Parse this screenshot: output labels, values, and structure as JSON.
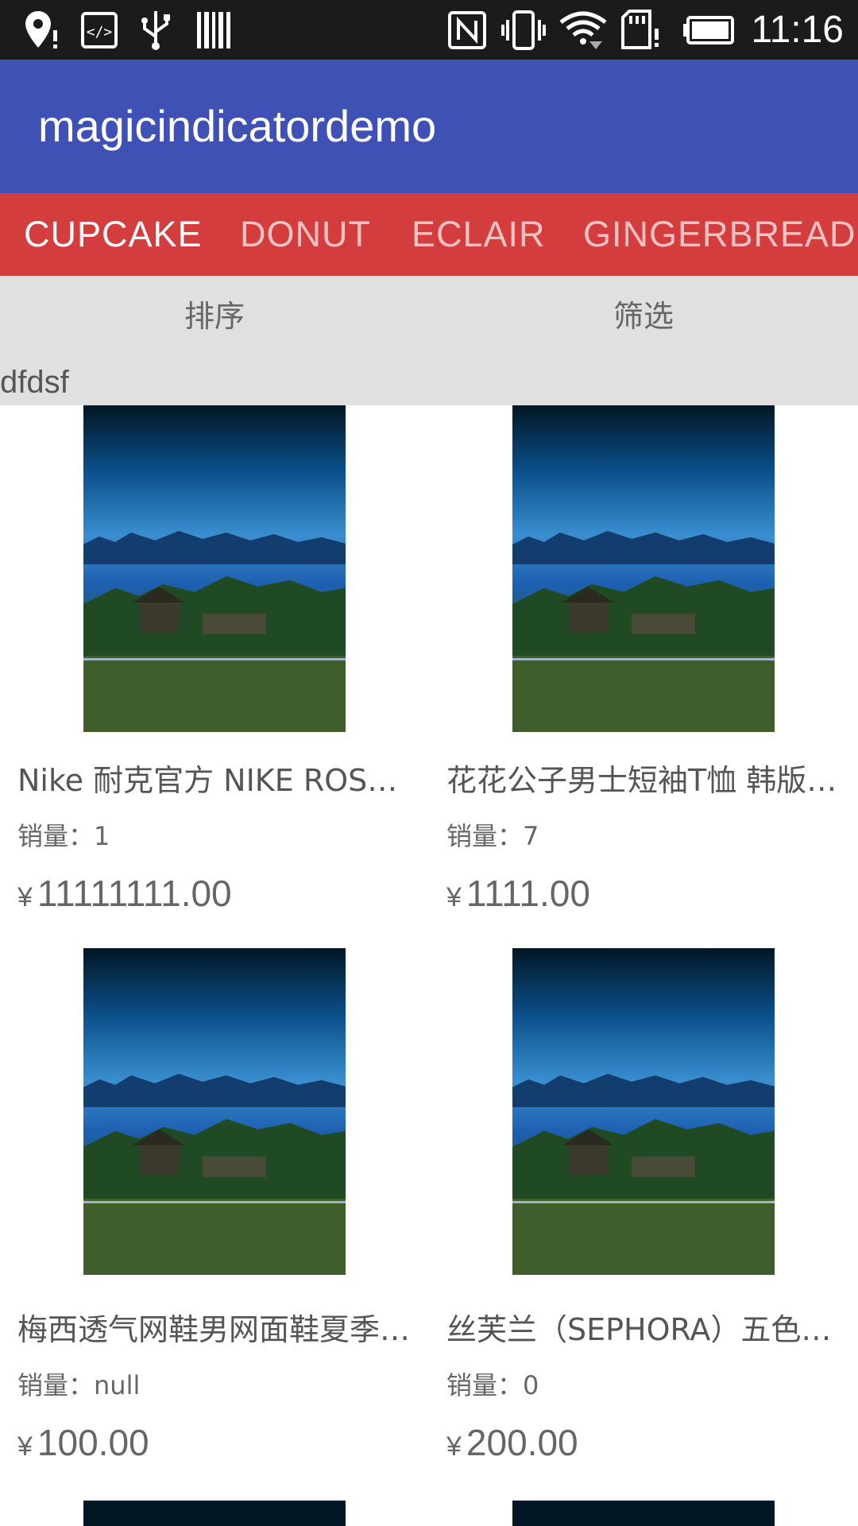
{
  "status_bar": {
    "time": "11:16",
    "icons": [
      "location-alert-icon",
      "code-icon",
      "usb-icon",
      "barcode-icon",
      "nfc-icon",
      "vibrate-icon",
      "wifi-icon",
      "sd-card-alert-icon",
      "battery-icon"
    ]
  },
  "app_bar": {
    "title": "magicindicatordemo",
    "background": "#3f51b5"
  },
  "tabs": {
    "background": "#d43d3d",
    "items": [
      {
        "label": "CUPCAKE",
        "active": true
      },
      {
        "label": "DONUT",
        "active": false
      },
      {
        "label": "ECLAIR",
        "active": false
      },
      {
        "label": "GINGERBREAD",
        "active": false
      }
    ]
  },
  "filter_bar": {
    "sort_label": "排序",
    "filter_label": "筛选",
    "note": "dfdsf"
  },
  "products": [
    {
      "title": "Nike 耐克官方 NIKE ROSHE ONE",
      "sales": "销量：1",
      "currency": "¥",
      "price": "11111111.00"
    },
    {
      "title": "花花公子男士短袖T恤 韩版修身",
      "sales": "销量：7",
      "currency": "¥",
      "price": "1111.00"
    },
    {
      "title": "梅西透气网鞋男网面鞋夏季跑步鞋",
      "sales": "销量：null",
      "currency": "¥",
      "price": "100.00"
    },
    {
      "title": "丝芙兰（SEPHORA）五色眼影盘",
      "sales": "销量：0",
      "currency": "¥",
      "price": "200.00"
    }
  ]
}
